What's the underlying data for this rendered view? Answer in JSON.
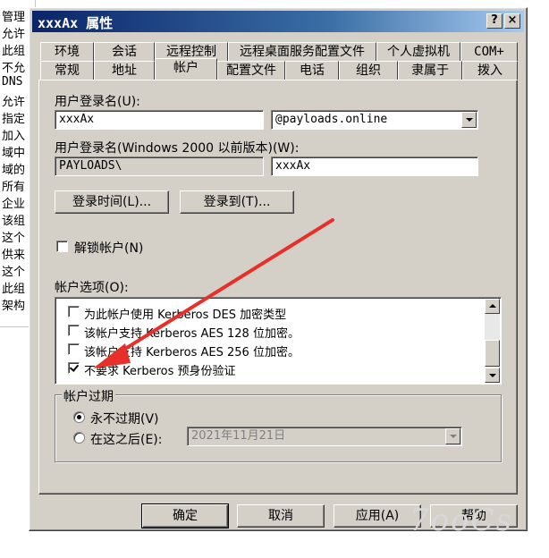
{
  "background_window": {
    "lines": [
      "管理",
      "允许",
      "此组",
      "不允",
      "DNS",
      "允许",
      "指定",
      "加入",
      "域中",
      "域的",
      "所有",
      "企业",
      "该组",
      "这个",
      "供来",
      "这个",
      "此组",
      "架构"
    ]
  },
  "dialog": {
    "title": "xxxAx 属性",
    "help_btn": "?",
    "close_btn": "×"
  },
  "tabs": {
    "row1": [
      "环境",
      "会话",
      "远程控制",
      "远程桌面服务配置文件",
      "个人虚拟机",
      "COM+"
    ],
    "row2": [
      "常规",
      "地址",
      "帐户",
      "配置文件",
      "电话",
      "组织",
      "隶属于",
      "拨入"
    ],
    "active": "帐户"
  },
  "account": {
    "logon_name_label": "用户登录名(U):",
    "logon_name_value": "xxxAx",
    "domain_suffix": "@payloads.online",
    "pre2000_label": "用户登录名(Windows 2000 以前版本)(W):",
    "pre2000_domain": "PAYLOADS\\",
    "pre2000_name": "xxxAx",
    "logon_hours_button": "登录时间(L)...",
    "logon_to_button": "登录到(T)...",
    "unlock_label": "解锁帐户(N)",
    "options_label": "帐户选项(O):",
    "options": [
      {
        "text": "为此帐户使用 Kerberos DES 加密类型",
        "checked": false
      },
      {
        "text": "该帐户支持 Kerberos AES 128 位加密。",
        "checked": false
      },
      {
        "text": "该帐户支持 Kerberos AES 256 位加密。",
        "checked": false
      },
      {
        "text": "不要求 Kerberos 预身份验证",
        "checked": true
      }
    ],
    "expire_group_title": "帐户过期",
    "never_expires": "永不过期(V)",
    "end_of": "在这之后(E):",
    "expire_date": "2021年11月21日"
  },
  "footer": {
    "ok": "确定",
    "cancel": "取消",
    "apply": "应用(A)",
    "help": "帮助"
  },
  "watermark": "7ooCs",
  "colors": {
    "face": "#d4d0c8",
    "title_start": "#0a246a",
    "title_end": "#a6caf0",
    "annotation_arrow": "#e8302a"
  }
}
